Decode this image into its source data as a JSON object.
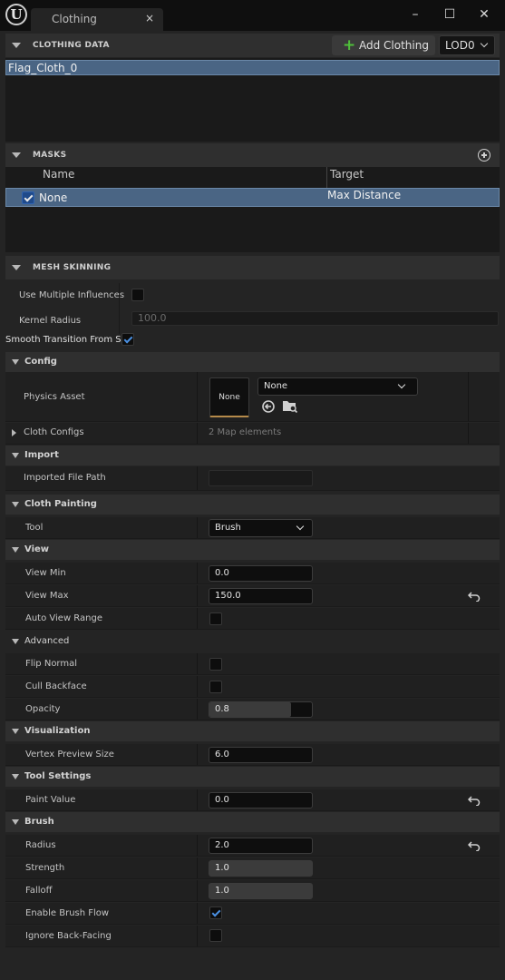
{
  "window": {
    "tab_title": "Clothing",
    "tab_close": "×",
    "minimize": "–",
    "maximize": "☐",
    "close": "✕"
  },
  "clothing_data": {
    "section_title": "CLOTHING DATA",
    "add_button": "Add Clothing",
    "lod": "LOD0",
    "items": [
      "Flag_Cloth_0"
    ]
  },
  "masks": {
    "section_title": "MASKS",
    "col_name": "Name",
    "col_target": "Target",
    "rows": [
      {
        "name": "None",
        "target": "Max Distance",
        "checked": true
      }
    ]
  },
  "mesh_skinning": {
    "section_title": "MESH SKINNING",
    "use_multiple_influences": "Use Multiple Influences",
    "kernel_radius_label": "Kernel Radius",
    "kernel_radius_value": "100.0",
    "smooth_transition": "Smooth Transition From Ski"
  },
  "details": {
    "config": "Config",
    "physics_asset": "Physics Asset",
    "physics_thumb": "None",
    "physics_value": "None",
    "cloth_configs": "Cloth Configs",
    "cloth_configs_value": "2 Map elements",
    "import": "Import",
    "imported_file_path": "Imported File Path",
    "cloth_painting": "Cloth Painting",
    "tool": "Tool",
    "tool_value": "Brush",
    "view": "View",
    "view_min": "View Min",
    "view_min_value": "0.0",
    "view_max": "View Max",
    "view_max_value": "150.0",
    "auto_view_range": "Auto View Range",
    "advanced": "Advanced",
    "flip_normal": "Flip Normal",
    "cull_backface": "Cull Backface",
    "opacity": "Opacity",
    "opacity_value": "0.8",
    "visualization": "Visualization",
    "vertex_preview_size": "Vertex Preview Size",
    "vertex_preview_size_value": "6.0",
    "tool_settings": "Tool Settings",
    "paint_value": "Paint Value",
    "paint_value_value": "0.0",
    "brush": "Brush",
    "radius": "Radius",
    "radius_value": "2.0",
    "strength": "Strength",
    "strength_value": "1.0",
    "falloff": "Falloff",
    "falloff_value": "1.0",
    "enable_brush_flow": "Enable Brush Flow",
    "ignore_back_facing": "Ignore Back-Facing"
  },
  "colors": {
    "accent_blue": "#4a6584",
    "add_green": "#4fbf3a",
    "thumb_underline": "#b58a4a"
  },
  "levels": {
    "opacity_fill_fraction": 0.8
  }
}
